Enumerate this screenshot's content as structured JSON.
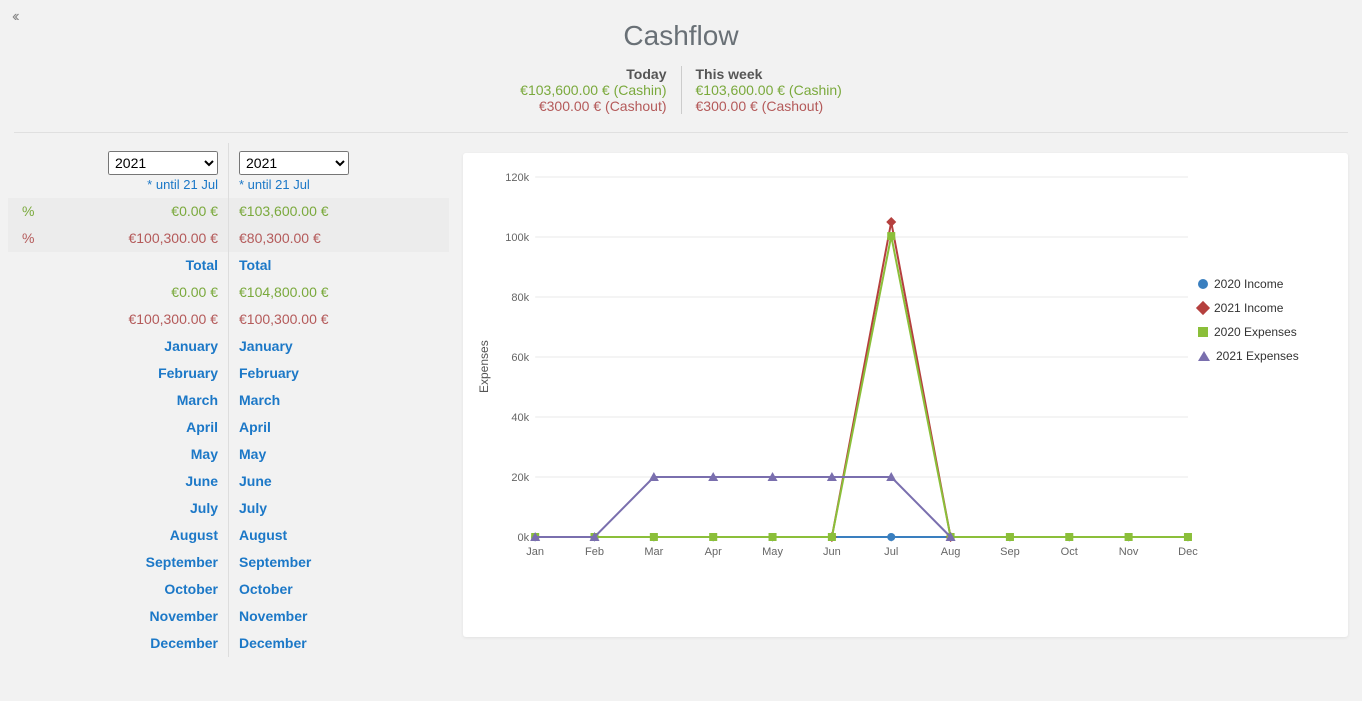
{
  "title": "Cashflow",
  "summary": {
    "today": {
      "label": "Today",
      "cashin": "€103,600.00 € (Cashin)",
      "cashout": "€300.00 € (Cashout)"
    },
    "thisweek": {
      "label": "This week",
      "cashin": "€103,600.00 € (Cashin)",
      "cashout": "€300.00 € (Cashout)"
    }
  },
  "columns": [
    {
      "year": "2021",
      "until": "* until 21 Jul",
      "pct_income": "€0.00 €",
      "pct_expense": "€100,300.00 €",
      "pct_symbol": "%",
      "total_label": "Total",
      "total_income": "€0.00 €",
      "total_expense": "€100,300.00 €"
    },
    {
      "year": "2021",
      "until": "* until 21 Jul",
      "pct_income": "€103,600.00 €",
      "pct_expense": "€80,300.00 €",
      "pct_symbol": "",
      "total_label": "Total",
      "total_income": "€104,800.00 €",
      "total_expense": "€100,300.00 €"
    }
  ],
  "months": [
    "January",
    "February",
    "March",
    "April",
    "May",
    "June",
    "July",
    "August",
    "September",
    "October",
    "November",
    "December"
  ],
  "colors": {
    "income_2020": "#3a7fbf",
    "income_2021": "#b5403e",
    "expense_2020": "#8bbf3a",
    "expense_2021": "#7a6fae"
  },
  "chart_data": {
    "type": "line",
    "title": "",
    "xlabel": "",
    "ylabel": "Expenses",
    "ylim": [
      0,
      120000
    ],
    "yticks": [
      0,
      20000,
      40000,
      60000,
      80000,
      100000,
      120000
    ],
    "ytick_labels": [
      "0k",
      "20k",
      "40k",
      "60k",
      "80k",
      "100k",
      "120k"
    ],
    "categories": [
      "Jan",
      "Feb",
      "Mar",
      "Apr",
      "May",
      "Jun",
      "Jul",
      "Aug",
      "Sep",
      "Oct",
      "Nov",
      "Dec"
    ],
    "series": [
      {
        "name": "2020 Income",
        "values": [
          0,
          0,
          0,
          0,
          0,
          0,
          0,
          0,
          0,
          0,
          0,
          0
        ],
        "color": "#3a7fbf",
        "marker": "circle"
      },
      {
        "name": "2021 Income",
        "values": [
          null,
          null,
          null,
          null,
          null,
          0,
          105000,
          0,
          null,
          null,
          null,
          null
        ],
        "color": "#b5403e",
        "marker": "diamond"
      },
      {
        "name": "2020 Expenses",
        "values": [
          0,
          0,
          0,
          0,
          0,
          0,
          100300,
          0,
          0,
          0,
          0,
          0
        ],
        "color": "#8bbf3a",
        "marker": "square"
      },
      {
        "name": "2021 Expenses",
        "values": [
          0,
          0,
          20000,
          20000,
          20000,
          20000,
          20000,
          0,
          null,
          null,
          null,
          null
        ],
        "color": "#7a6fae",
        "marker": "triangle"
      }
    ]
  }
}
